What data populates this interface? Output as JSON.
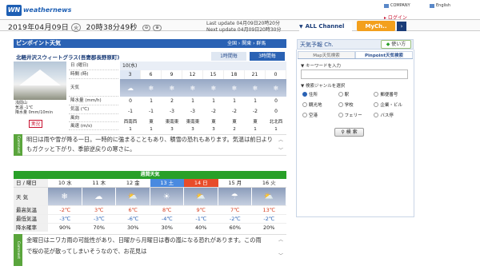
{
  "header": {
    "logo": "WN",
    "logo_text": "weathernews",
    "links": [
      {
        "icon": "company-icon",
        "label": "COMPANY"
      },
      {
        "icon": "window-icon",
        "label": "English"
      }
    ],
    "login": "ログイン",
    "date": "2019年04月09日",
    "weekday": "火",
    "time": "20時38分49秒",
    "update1": "Last update 04月09日20時20分",
    "update2": "Next update 04月09日20時30分",
    "all_channel": "ALL Channel",
    "mych": "MyCh.."
  },
  "pinpoint": {
    "title": "ピンポイント天気",
    "nav": "全国 › 関東 › 群馬",
    "location": "北軽井沢スウィートグラス(吾妻郡長野原町)",
    "tab_1h": "1時間毎",
    "tab_3h": "3時間毎",
    "obs": [
      "浅間山",
      "気温 -1℃",
      "降水量 0mm/10min"
    ],
    "stamp": "実況",
    "row_labels": [
      "日 (曜日)",
      "時間 (時)",
      "天気",
      "",
      "降水量 (mm/h)",
      "気温 (℃)",
      "風向",
      "風速 (m/s)"
    ],
    "day": "10(水)",
    "hours": [
      "3",
      "6",
      "9",
      "12",
      "15",
      "18",
      "21",
      "0"
    ],
    "weather_icons": [
      "cloud-icon",
      "snow-icon",
      "snow-icon",
      "snow-icon",
      "snow-icon",
      "snow-icon",
      "snow-icon",
      "snow-icon"
    ],
    "precip": [
      "0",
      "1",
      "2",
      "1",
      "1",
      "1",
      "1",
      "0"
    ],
    "temp": [
      "-1",
      "-1",
      "-3",
      "-3",
      "-2",
      "-2",
      "-2",
      "0"
    ],
    "wind_dir": [
      "西南西",
      "東",
      "東南東",
      "東南東",
      "東",
      "東",
      "東",
      "北北西"
    ],
    "wind_speed": [
      "1",
      "1",
      "3",
      "3",
      "3",
      "2",
      "1",
      "1"
    ],
    "comment_tag": "Comment",
    "comment": "明日は雨や雪が降る一日。一時的に強まることもあり、積雪の恐れもあります。気温は前日よりもガクッと下がり、季節逆戻りの寒さに。"
  },
  "weekly": {
    "title": "週間天気",
    "header_label": "日 / 曜日",
    "days": [
      "10 水",
      "11 木",
      "12 金",
      "13 土",
      "14 日",
      "15 月",
      "16 火"
    ],
    "weather_label": "天 気",
    "icons": [
      "snow-icon",
      "cloud-snow-icon",
      "sun-cloud-icon",
      "sun-icon",
      "sun-cloud-icon",
      "cloud-rain-icon",
      "sun-cloud-icon"
    ],
    "max_label": "最高気温",
    "max": [
      "-2℃",
      "3℃",
      "6℃",
      "8℃",
      "9℃",
      "7℃",
      "13℃"
    ],
    "min_label": "最低気温",
    "min": [
      "-3℃",
      "-3℃",
      "-6℃",
      "-4℃",
      "-1℃",
      "-2℃",
      "-2℃"
    ],
    "pop_label": "降水確率",
    "pop": [
      "90%",
      "70%",
      "30%",
      "30%",
      "40%",
      "60%",
      "20%"
    ],
    "comment_tag": "Comment",
    "comment": "金曜日はニワカ雨の可能性があり、日曜から月曜日は春の嵐になる恐れがあります。この雨で桜の花が散ってしまいそうなので、お花見は"
  },
  "channel": {
    "title": "天気予報 Ch.",
    "usage": "使い方",
    "tabs": [
      "Map天気検索",
      "Pinpoint天気検索"
    ],
    "keyword_label": "▼ キーワードを入力",
    "keyword_placeholder": "",
    "genre_label": "▼ 検索ジャンルを選択",
    "genres": [
      "住所",
      "駅",
      "郵便番号",
      "観光地",
      "学校",
      "企業・ビル",
      "空港",
      "フェリー",
      "バス停"
    ],
    "search": "検 索"
  },
  "colors": {
    "blue": "#2a62b4",
    "green": "#28a028",
    "orange": "#f3a01d",
    "sat": "#4a8ae0",
    "sun": "#e84c2a"
  }
}
